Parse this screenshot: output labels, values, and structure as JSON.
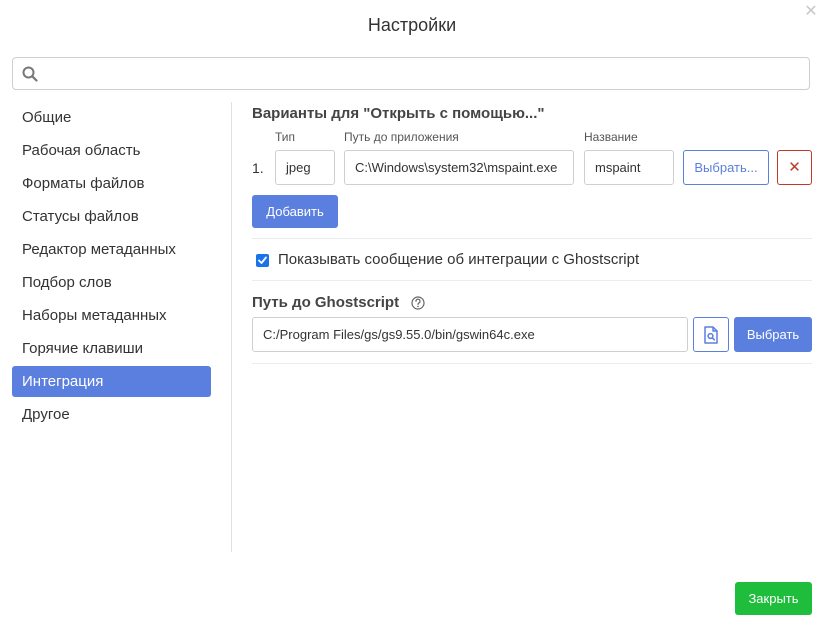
{
  "dialog": {
    "title": "Настройки",
    "close_icon": "close-icon"
  },
  "search": {
    "placeholder": "",
    "value": "",
    "icon": "search-icon"
  },
  "sidebar": {
    "items": [
      {
        "label": "Общие",
        "active": false
      },
      {
        "label": "Рабочая область",
        "active": false
      },
      {
        "label": "Форматы файлов",
        "active": false
      },
      {
        "label": "Статусы файлов",
        "active": false
      },
      {
        "label": "Редактор метаданных",
        "active": false
      },
      {
        "label": "Подбор слов",
        "active": false
      },
      {
        "label": "Наборы метаданных",
        "active": false
      },
      {
        "label": "Горячие клавиши",
        "active": false
      },
      {
        "label": "Интеграция",
        "active": true
      },
      {
        "label": "Другое",
        "active": false
      }
    ]
  },
  "open_with": {
    "title": "Варианты для \"Открыть с помощью...\"",
    "columns": {
      "type": "Тип",
      "path": "Путь до приложения",
      "name": "Название"
    },
    "rows": [
      {
        "number": "1.",
        "type": "jpeg",
        "path": "C:\\Windows\\system32\\mspaint.exe",
        "name": "mspaint",
        "choose_label": "Выбрать...",
        "delete_label": "✕"
      }
    ],
    "add_label": "Добавить"
  },
  "ghostscript_message": {
    "checked": true,
    "label": "Показывать сообщение об интеграции с Ghostscript"
  },
  "ghostscript_path": {
    "title": "Путь до Ghostscript",
    "help_icon": "help-circle-icon",
    "value": "C:/Program Files/gs/gs9.55.0/bin/gswin64c.exe",
    "file_icon": "file-search-icon",
    "choose_label": "Выбрать"
  },
  "footer": {
    "close_label": "Закрыть"
  },
  "colors": {
    "accent": "#5b7fdf",
    "close_button": "#1fbd3c",
    "delete": "#c0392b",
    "checkbox": "#1a73e8"
  }
}
